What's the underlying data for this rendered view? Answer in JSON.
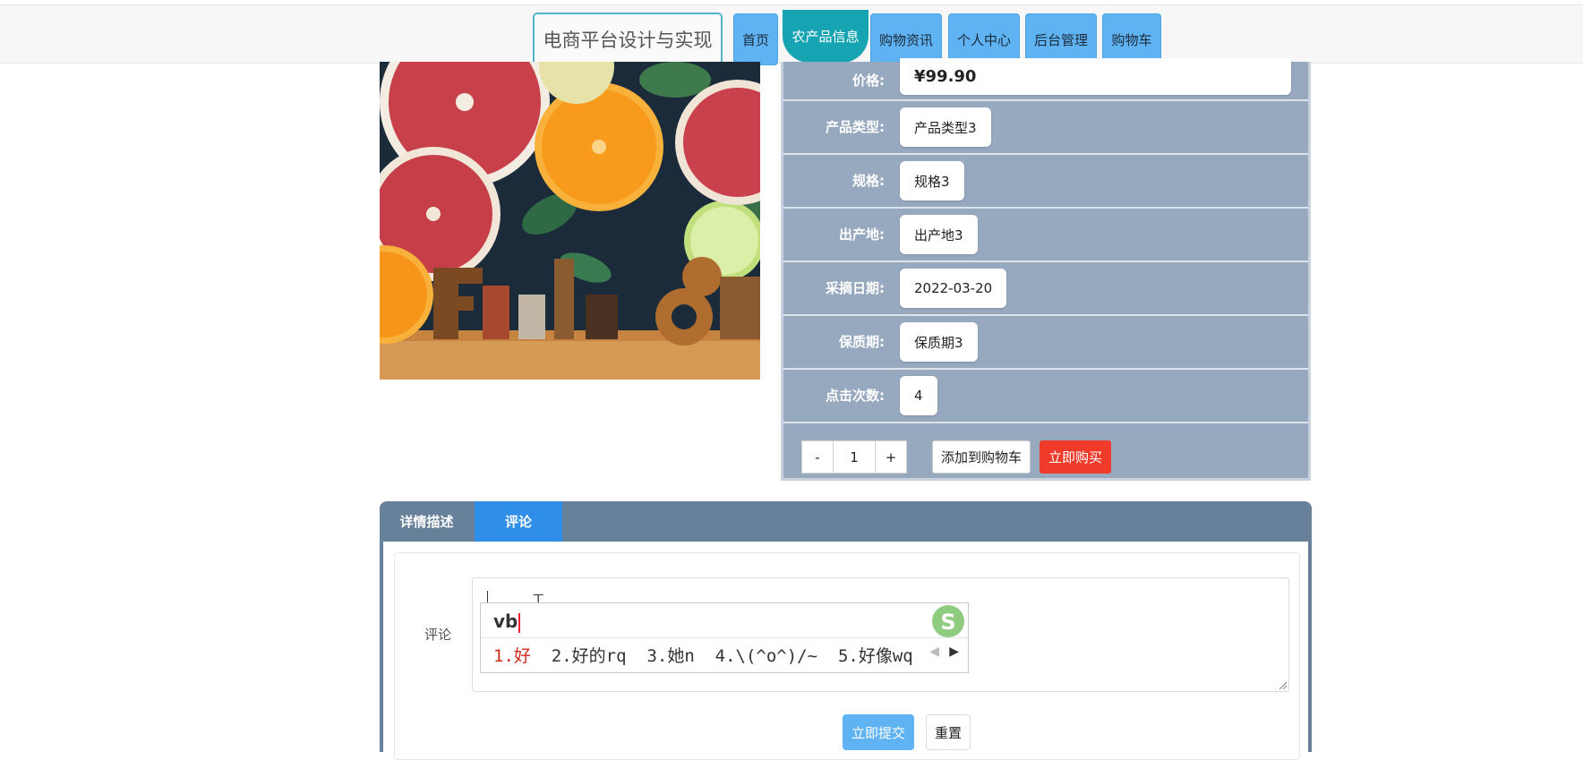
{
  "header": {
    "site_title": "电商平台设计与实现",
    "nav": [
      "首页",
      "农产品信息",
      "购物资讯",
      "个人中心",
      "后台管理",
      "购物车"
    ],
    "active_nav": "农产品信息"
  },
  "product": {
    "image_icon": "fruit-photo",
    "fields": [
      {
        "label": "价格:",
        "value": "¥99.90"
      },
      {
        "label": "产品类型:",
        "value": "产品类型3"
      },
      {
        "label": "规格:",
        "value": "规格3"
      },
      {
        "label": "出产地:",
        "value": "出产地3"
      },
      {
        "label": "采摘日期:",
        "value": "2022-03-20"
      },
      {
        "label": "保质期:",
        "value": "保质期3"
      },
      {
        "label": "点击次数:",
        "value": "4"
      }
    ],
    "quantity": {
      "minus": "-",
      "value": "1",
      "plus": "+"
    },
    "add_to_cart": "添加到购物车",
    "buy_now": "立即购买"
  },
  "tabs": {
    "items": [
      "详情描述",
      "评论"
    ],
    "active": "评论"
  },
  "comment_form": {
    "label": "评论",
    "submit": "立即提交",
    "reset": "重置"
  },
  "ime": {
    "composition": "vb",
    "candidates": [
      "1.好",
      "2.好的rq",
      "3.她n",
      "4.\\(^o^)/~",
      "5.好像wq"
    ]
  },
  "colors": {
    "nav_bg": "#5fb3f3",
    "nav_active": "#17a4b2",
    "panel_bg": "#97a9bf",
    "tab_bar": "#67819b",
    "tab_active": "#2e8ee8",
    "buy_now": "#f03a2a",
    "submit": "#5fb3f3"
  }
}
